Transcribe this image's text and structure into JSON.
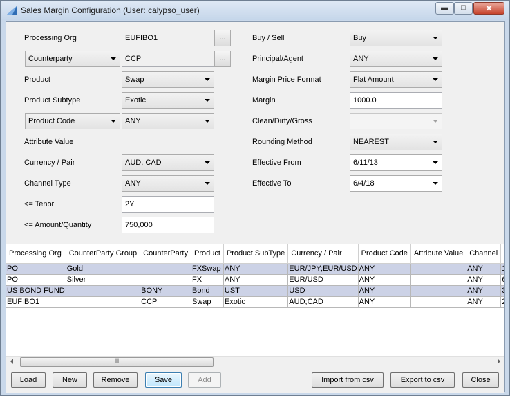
{
  "window": {
    "title": "Sales Margin Configuration (User: calypso_user)",
    "minimize_glyph": "▬",
    "maximize_glyph": "□",
    "close_glyph": "✕"
  },
  "form": {
    "left": {
      "processing_org_label": "Processing Org",
      "processing_org_value": "EUFIBO1",
      "ellipsis": "...",
      "counterparty_selector": "Counterparty",
      "counterparty_value": "CCP",
      "product_label": "Product",
      "product_value": "Swap",
      "product_subtype_label": "Product Subtype",
      "product_subtype_value": "Exotic",
      "product_code_selector": "Product Code",
      "product_code_value": "ANY",
      "attribute_value_label": "Attribute Value",
      "attribute_value_value": "",
      "currency_pair_label": "Currency / Pair",
      "currency_pair_value": "AUD, CAD",
      "channel_type_label": "Channel Type",
      "channel_type_value": "ANY",
      "tenor_label": "<= Tenor",
      "tenor_value": "2Y",
      "amount_label": "<= Amount/Quantity",
      "amount_value": "750,000"
    },
    "right": {
      "buy_sell_label": "Buy / Sell",
      "buy_sell_value": "Buy",
      "principal_agent_label": "Principal/Agent",
      "principal_agent_value": "ANY",
      "margin_price_format_label": "Margin Price Format",
      "margin_price_format_value": "Flat Amount",
      "margin_label": "Margin",
      "margin_value": "1000.0",
      "clean_dirty_label": "Clean/Dirty/Gross",
      "clean_dirty_value": "",
      "rounding_method_label": "Rounding Method",
      "rounding_method_value": "NEAREST",
      "effective_from_label": "Effective From",
      "effective_from_value": "6/11/13",
      "effective_to_label": "Effective To",
      "effective_to_value": "6/4/18"
    }
  },
  "table": {
    "columns": [
      "Processing Org",
      "CounterParty Group",
      "CounterParty",
      "Product",
      "Product SubType",
      "Currency / Pair",
      "Product Code",
      "Attribute Value",
      "Channel",
      ""
    ],
    "rows": [
      [
        "PO",
        "Gold",
        "",
        "FXSwap",
        "ANY",
        "EUR/JPY;EUR/USD",
        "ANY",
        "",
        "ANY",
        "1"
      ],
      [
        "PO",
        "Silver",
        "",
        "FX",
        "ANY",
        "EUR/USD",
        "ANY",
        "",
        "ANY",
        "6"
      ],
      [
        "US BOND FUND",
        "",
        "BONY",
        "Bond",
        "UST",
        "USD",
        "ANY",
        "",
        "ANY",
        "3"
      ],
      [
        "EUFIBO1",
        "",
        "CCP",
        "Swap",
        "Exotic",
        "AUD;CAD",
        "ANY",
        "",
        "ANY",
        "2"
      ]
    ],
    "scroll_grip": "III"
  },
  "buttons": {
    "load": "Load",
    "new": "New",
    "remove": "Remove",
    "save": "Save",
    "add": "Add",
    "import_csv": "Import from csv",
    "export_csv": "Export to csv",
    "close": "Close"
  }
}
